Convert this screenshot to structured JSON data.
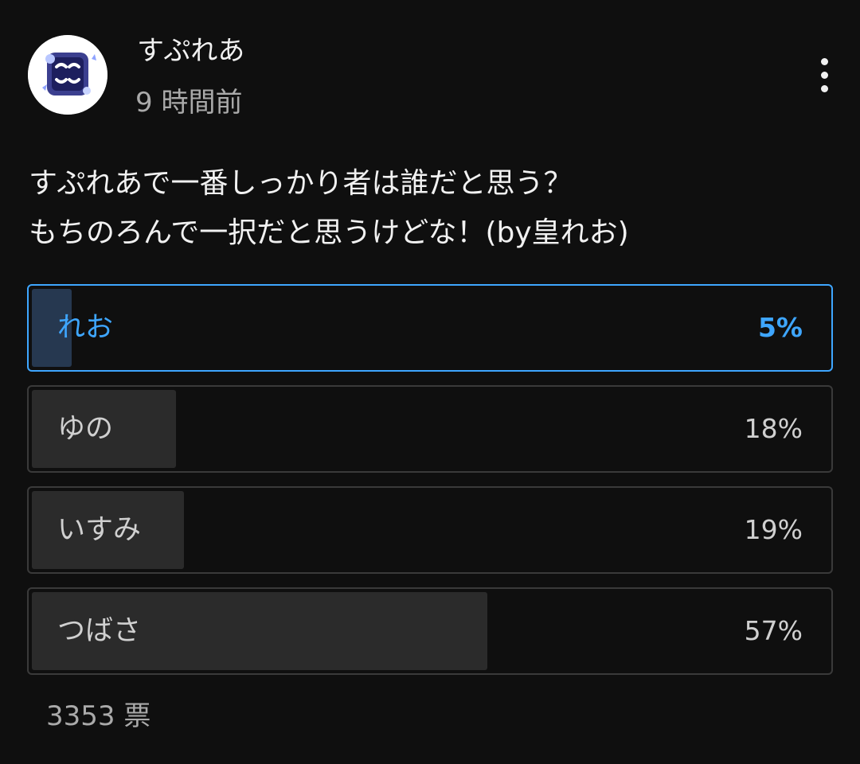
{
  "post": {
    "channel_name": "すぷれあ",
    "time": "9 時間前",
    "text": "すぷれあで一番しっかり者は誰だと思う？\nもちのろんで一択だと思うけどな！(by皇れお)",
    "avatar_icon": "channel-logo-avatar",
    "menu_icon": "more-vertical-icon"
  },
  "poll": {
    "options": [
      {
        "label": "れお",
        "percent": "5%",
        "value": 5,
        "selected": true
      },
      {
        "label": "ゆの",
        "percent": "18%",
        "value": 18,
        "selected": false
      },
      {
        "label": "いすみ",
        "percent": "19%",
        "value": 19,
        "selected": false
      },
      {
        "label": "つばさ",
        "percent": "57%",
        "value": 57,
        "selected": false
      }
    ],
    "votes": "3353 票"
  },
  "colors": {
    "background": "#0f0f0f",
    "accent": "#3ea6ff",
    "border": "#3a3a3a",
    "fill": "#2b2b2b",
    "selected_fill": "#263850",
    "muted_text": "#aaaaaa"
  }
}
